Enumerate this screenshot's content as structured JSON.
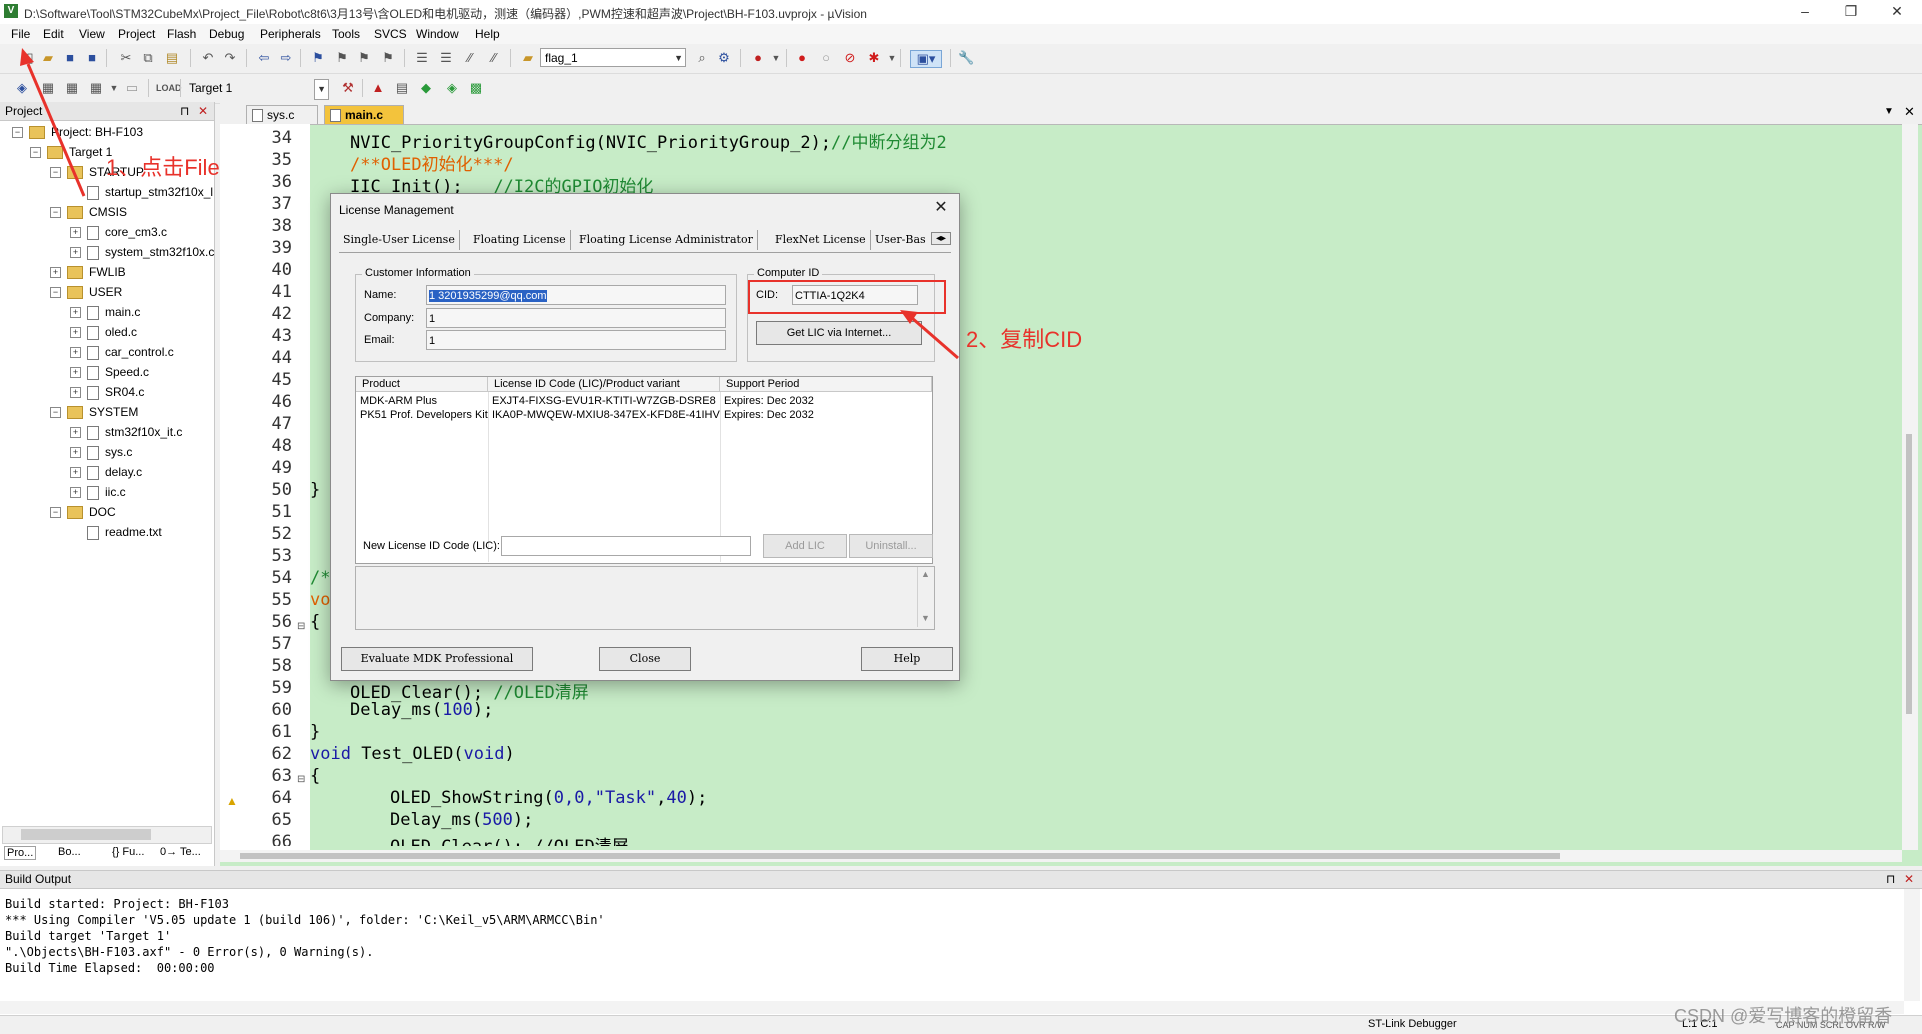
{
  "window": {
    "title": "D:\\Software\\Tool\\STM32CubeMx\\Project_File\\Robot\\c8t6\\3月13号\\含OLED和电机驱动，测速（编码器）,PWM控速和超声波\\Project\\BH-F103.uvprojx - µVision",
    "app_icon": "V",
    "minimize": "–",
    "maximize": "❐",
    "close": "✕"
  },
  "menu": [
    "File",
    "Edit",
    "View",
    "Project",
    "Flash",
    "Debug",
    "Peripherals",
    "Tools",
    "SVCS",
    "Window",
    "Help"
  ],
  "toolbar": {
    "find_value": "flag_1",
    "target_value": "Target 1"
  },
  "project_panel": {
    "title": "Project",
    "pin": "⊓",
    "close": "✕",
    "tree": [
      {
        "label": "Project: BH-F103",
        "depth": 0,
        "kind": "root",
        "exp": "−"
      },
      {
        "label": "Target 1",
        "depth": 1,
        "kind": "target",
        "exp": "−"
      },
      {
        "label": "STARTUP",
        "depth": 2,
        "kind": "folder",
        "exp": "−"
      },
      {
        "label": "startup_stm32f10x_l",
        "depth": 3,
        "kind": "file",
        "exp": ""
      },
      {
        "label": "CMSIS",
        "depth": 2,
        "kind": "folder",
        "exp": "−"
      },
      {
        "label": "core_cm3.c",
        "depth": 3,
        "kind": "file",
        "exp": "+"
      },
      {
        "label": "system_stm32f10x.c",
        "depth": 3,
        "kind": "file",
        "exp": "+"
      },
      {
        "label": "FWLIB",
        "depth": 2,
        "kind": "folder",
        "exp": "+"
      },
      {
        "label": "USER",
        "depth": 2,
        "kind": "folder",
        "exp": "−"
      },
      {
        "label": "main.c",
        "depth": 3,
        "kind": "file",
        "exp": "+"
      },
      {
        "label": "oled.c",
        "depth": 3,
        "kind": "file",
        "exp": "+"
      },
      {
        "label": "car_control.c",
        "depth": 3,
        "kind": "file",
        "exp": "+"
      },
      {
        "label": "Speed.c",
        "depth": 3,
        "kind": "file",
        "exp": "+"
      },
      {
        "label": "SR04.c",
        "depth": 3,
        "kind": "file",
        "exp": "+"
      },
      {
        "label": "SYSTEM",
        "depth": 2,
        "kind": "folder",
        "exp": "−"
      },
      {
        "label": "stm32f10x_it.c",
        "depth": 3,
        "kind": "file",
        "exp": "+"
      },
      {
        "label": "sys.c",
        "depth": 3,
        "kind": "file",
        "exp": "+"
      },
      {
        "label": "delay.c",
        "depth": 3,
        "kind": "file",
        "exp": "+"
      },
      {
        "label": "iic.c",
        "depth": 3,
        "kind": "file",
        "exp": "+"
      },
      {
        "label": "DOC",
        "depth": 2,
        "kind": "folder",
        "exp": "−"
      },
      {
        "label": "readme.txt",
        "depth": 3,
        "kind": "file",
        "exp": ""
      }
    ],
    "bottom_tabs": [
      "Pro...",
      "Bo...",
      "{} Fu...",
      "0→ Te..."
    ]
  },
  "editor": {
    "tabs": [
      "sys.c",
      "main.c"
    ],
    "line_numbers": [
      "34",
      "35",
      "36",
      "37",
      "38",
      "39",
      "40",
      "41",
      "42",
      "43",
      "44",
      "45",
      "46",
      "47",
      "48",
      "49",
      "50",
      "51",
      "52",
      "53",
      "54",
      "55",
      "56",
      "57",
      "58",
      "59",
      "60",
      "61",
      "62",
      "63",
      "64",
      "65",
      "66"
    ],
    "code": {
      "l34": "NVIC_PriorityGroupConfig(NVIC_PriorityGroup_2);",
      "l34c": "//中断分组为2",
      "l35": "/**OLED初始化***/",
      "l36": "IIC_Init();",
      "l36c": "//I2C的GPIO初始化",
      "l50": "}",
      "l54": "/*",
      "l55": "vo",
      "l56": "{",
      "l59": "OLED_Clear();",
      "l59c": "//OLED清屏",
      "l60a": "Delay_ms(",
      "l60n": "100",
      "l60b": ");",
      "l61": "}",
      "l62k": "void",
      "l62a": " Test_OLED(",
      "l62k2": "void",
      "l62b": ")",
      "l63": "{",
      "l64a": "OLED_ShowString(",
      "l64n": "0,0,",
      "l64s": "\"Task\"",
      "l64c": ",",
      "l64n2": "40",
      "l64b": ");",
      "l65a": "Delay_ms(",
      "l65n": "500",
      "l65b": ");",
      "l66": "OLED_Clear(); //OLED清屏"
    }
  },
  "dialog": {
    "title": "License Management",
    "close": "✕",
    "tabs": [
      "Single-User License",
      "Floating License",
      "Floating License Administrator",
      "FlexNet License",
      "User-Bas"
    ],
    "customer_group": "Customer Information",
    "name_label": "Name:",
    "name_value": "1 3201935299@qq.com",
    "company_label": "Company:",
    "company_value": "1",
    "email_label": "Email:",
    "email_value": "1",
    "computer_group": "Computer ID",
    "cid_label": "CID:",
    "cid_value": "CTTIA-1Q2K4",
    "get_lic_button": "Get LIC via Internet...",
    "list_headers": [
      "Product",
      "License ID Code (LIC)/Product variant",
      "Support Period"
    ],
    "list_rows": [
      [
        "MDK-ARM Plus",
        "EXJT4-FIXSG-EVU1R-KTITI-W7ZGB-DSRE8",
        "Expires: Dec 2032"
      ],
      [
        "PK51 Prof. Developers Kit",
        "IKA0P-MWQEW-MXIU8-347EX-KFD8E-41IHV",
        "Expires: Dec 2032"
      ]
    ],
    "new_lic_label": "New License ID Code (LIC):",
    "new_lic_value": "",
    "add_lic_button": "Add LIC",
    "uninstall_button": "Uninstall...",
    "evaluate_button": "Evaluate MDK Professional",
    "close_button": "Close",
    "help_button": "Help"
  },
  "build_output": {
    "title": "Build Output",
    "lines": [
      "Build started: Project: BH-F103",
      "*** Using Compiler 'V5.05 update 1 (build 106)', folder: 'C:\\Keil_v5\\ARM\\ARMCC\\Bin'",
      "Build target 'Target 1'",
      "\".\\Objects\\BH-F103.axf\" - 0 Error(s), 0 Warning(s).",
      "Build Time Elapsed:  00:00:00"
    ]
  },
  "statusbar": {
    "debugger": "ST-Link Debugger",
    "position": "L:1 C:1",
    "caps": "CAP  NUM  SCRL  OVR  R/W"
  },
  "annotations": {
    "step1": "1、点击File",
    "step2": "2、复制CID",
    "watermark": "CSDN @爱写博客的橙留香",
    "color": "#e8322b"
  }
}
